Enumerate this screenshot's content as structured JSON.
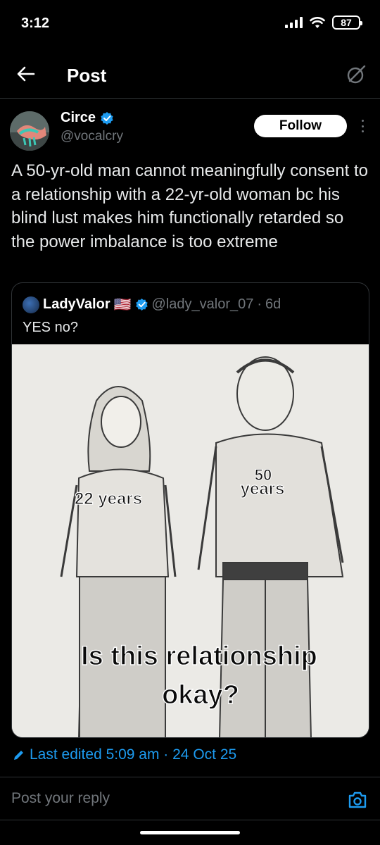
{
  "status_bar": {
    "time": "3:12",
    "battery": "87"
  },
  "header": {
    "title": "Post",
    "back_icon": "arrow-left-icon",
    "grok_icon": "grok-icon"
  },
  "tweet": {
    "author_name": "Circe",
    "author_handle": "@vocalcry",
    "follow_label": "Follow",
    "text": "A 50-yr-old man cannot meaningfully consent to a relationship with a 22-yr-old woman bc his blind lust makes him functionally retarded so the power imbalance is too extreme",
    "quote": {
      "author_name": "LadyValor",
      "flag": "🇺🇸",
      "handle": "@lady_valor_07",
      "separator": "·",
      "age": "6d",
      "text": "YES no?",
      "image": {
        "label_left": "22 years",
        "label_right_top": "50",
        "label_right_bottom": "years",
        "caption_line1": "Is this relationship",
        "caption_line2": "okay?"
      }
    },
    "edited": "Last edited 5:09 am · 24 Oct 25"
  },
  "reply": {
    "placeholder": "Post your reply"
  },
  "colors": {
    "accent": "#1d9bf0",
    "muted": "#71767b",
    "border": "#2f3336"
  }
}
